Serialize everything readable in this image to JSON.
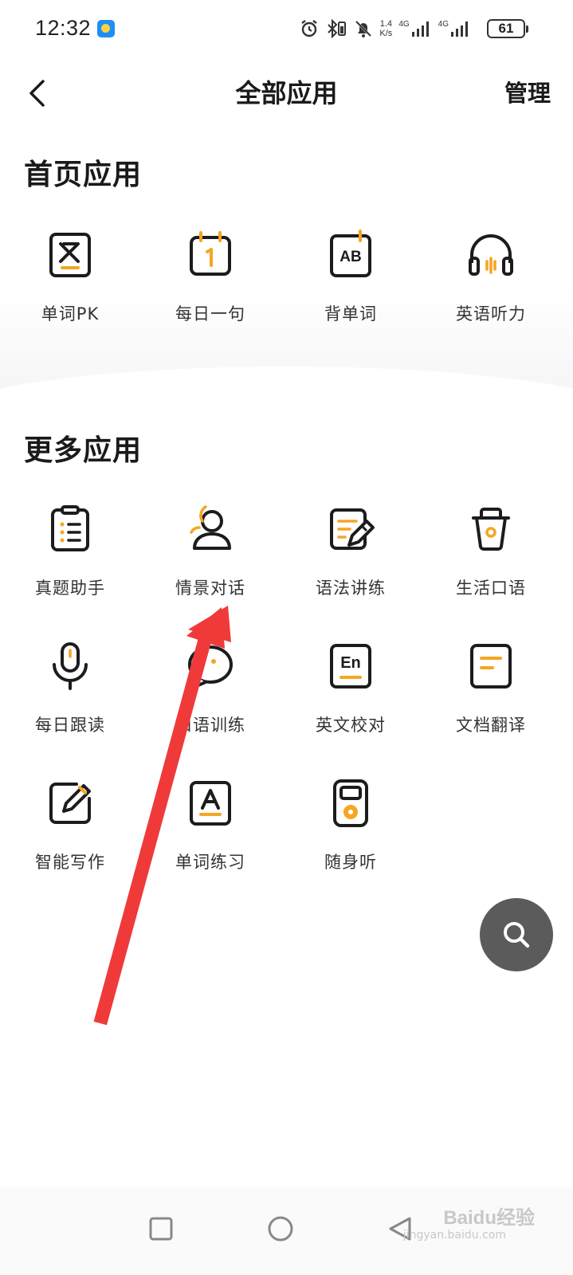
{
  "status_bar": {
    "time": "12:32",
    "speed_top": "1.4",
    "speed_bottom": "K/s",
    "net1": "4G",
    "net2": "4G",
    "battery": "61"
  },
  "header": {
    "title": "全部应用",
    "manage_label": "管理"
  },
  "home_section": {
    "title": "首页应用",
    "apps": [
      {
        "label": "单词PK",
        "icon": "word-pk-icon"
      },
      {
        "label": "每日一句",
        "icon": "calendar-icon"
      },
      {
        "label": "背单词",
        "icon": "ab-card-icon"
      },
      {
        "label": "英语听力",
        "icon": "headphones-icon"
      }
    ]
  },
  "more_section": {
    "title": "更多应用",
    "apps": [
      {
        "label": "真题助手",
        "icon": "clipboard-icon"
      },
      {
        "label": "情景对话",
        "icon": "person-icon"
      },
      {
        "label": "语法讲练",
        "icon": "edit-note-icon"
      },
      {
        "label": "生活口语",
        "icon": "cup-icon"
      },
      {
        "label": "每日跟读",
        "icon": "microphone-icon"
      },
      {
        "label": "口语训练",
        "icon": "chat-bubble-icon"
      },
      {
        "label": "英文校对",
        "icon": "en-check-icon"
      },
      {
        "label": "文档翻译",
        "icon": "document-icon"
      },
      {
        "label": "智能写作",
        "icon": "pencil-write-icon"
      },
      {
        "label": "单词练习",
        "icon": "letter-a-icon"
      },
      {
        "label": "随身听",
        "icon": "music-player-icon"
      }
    ]
  },
  "watermark": {
    "text": "Baidu经验",
    "sub": "jingyan.baidu.com"
  },
  "colors": {
    "accent": "#f5a623",
    "icon_stroke": "#1c1c1e",
    "annotation": "#f03a3a",
    "fab": "#5b5b5b"
  }
}
